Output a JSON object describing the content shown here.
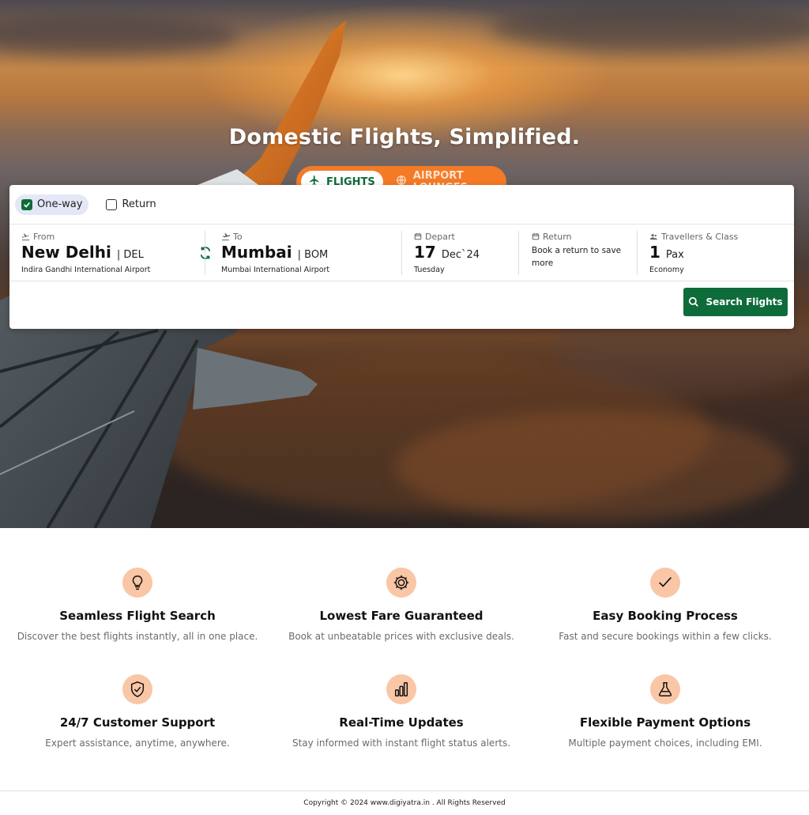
{
  "hero": {
    "title": "Domestic Flights, Simplified."
  },
  "tabs": [
    {
      "label": "FLIGHTS",
      "icon": "airplane-icon",
      "active": true
    },
    {
      "label": "AIRPORT LOUNGES",
      "icon": "globe-icon",
      "active": false
    }
  ],
  "trip_type": {
    "one_way": "One-way",
    "return": "Return",
    "selected": "One-way"
  },
  "search": {
    "from": {
      "label": "From",
      "city": "New Delhi",
      "code": "| DEL",
      "airport": "Indira Gandhi International Airport"
    },
    "to": {
      "label": "To",
      "city": "Mumbai",
      "code": "| BOM",
      "airport": "Mumbai International Airport"
    },
    "depart": {
      "label": "Depart",
      "day": "17",
      "month": "Dec`24",
      "weekday": "Tuesday"
    },
    "return": {
      "label": "Return",
      "hint": "Book a return to save more"
    },
    "travellers": {
      "label": "Travellers & Class",
      "count": "1",
      "unit": "Pax",
      "class": "Economy"
    },
    "button": "Search Flights"
  },
  "features": [
    {
      "title": "Seamless Flight Search",
      "desc": "Discover the best flights instantly, all in one place.",
      "icon": "lightbulb-icon"
    },
    {
      "title": "Lowest Fare Guaranteed",
      "desc": "Book at unbeatable prices with exclusive deals.",
      "icon": "gear-icon"
    },
    {
      "title": "Easy Booking Process",
      "desc": "Fast and secure bookings within a few clicks.",
      "icon": "checkmark-icon"
    },
    {
      "title": "24/7 Customer Support",
      "desc": "Expert assistance, anytime, anywhere.",
      "icon": "shield-check-icon"
    },
    {
      "title": "Real-Time Updates",
      "desc": "Stay informed with instant flight status alerts.",
      "icon": "bar-chart-icon"
    },
    {
      "title": "Flexible Payment Options",
      "desc": "Multiple payment choices, including EMI.",
      "icon": "flask-icon"
    }
  ],
  "footer": {
    "text": "Copyright © 2024 www.digiyatra.in . All Rights Reserved"
  },
  "colors": {
    "brand_green": "#0e6b3a",
    "brand_orange": "#f47a26",
    "icon_bg": "#f9c6a6"
  }
}
